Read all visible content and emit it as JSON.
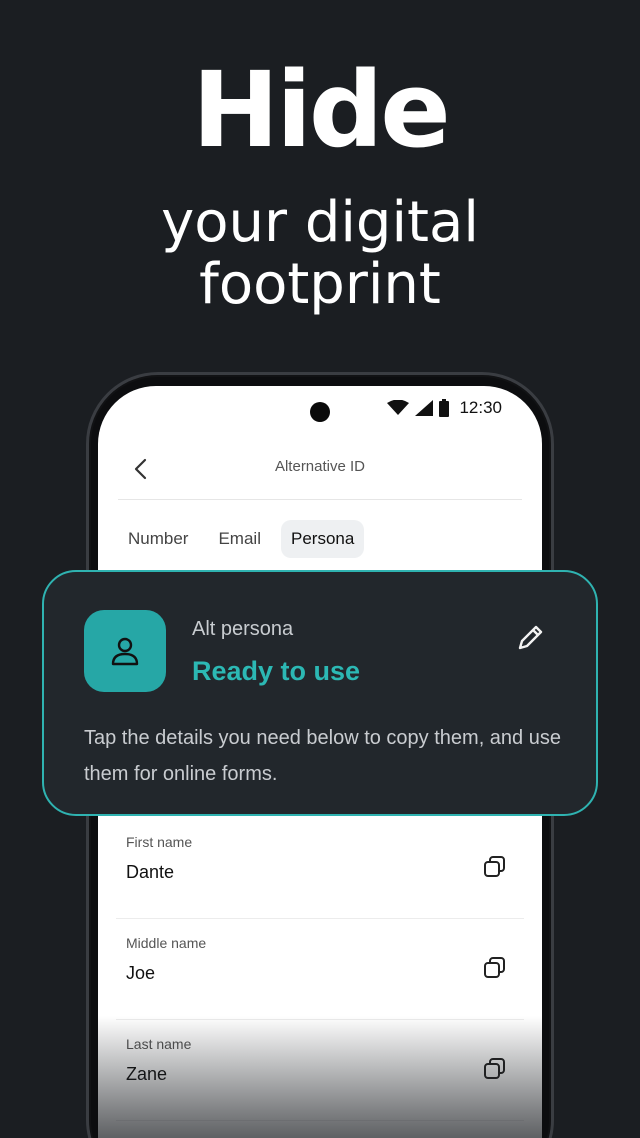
{
  "hero": {
    "title": "Hide",
    "subtitle_line1": "your digital",
    "subtitle_line2": "footprint"
  },
  "status_bar": {
    "time": "12:30",
    "icons": [
      "wifi-icon",
      "signal-icon",
      "battery-icon"
    ]
  },
  "appbar": {
    "title": "Alternative ID",
    "back_icon": "chevron-left-icon"
  },
  "tabs": [
    {
      "label": "Number",
      "active": false
    },
    {
      "label": "Email",
      "active": false
    },
    {
      "label": "Persona",
      "active": true
    }
  ],
  "card": {
    "label": "Alt persona",
    "status": "Ready to use",
    "description": "Tap the details you need below to copy them, and use them for online forms.",
    "icon": "person-icon",
    "edit_icon": "pencil-icon"
  },
  "fields": [
    {
      "label": "First name",
      "value": "Dante"
    },
    {
      "label": "Middle name",
      "value": "Joe"
    },
    {
      "label": "Last name",
      "value": "Zane"
    }
  ],
  "colors": {
    "accent": "#2cb8b4",
    "background": "#1b1e22",
    "card": "#22272c"
  }
}
